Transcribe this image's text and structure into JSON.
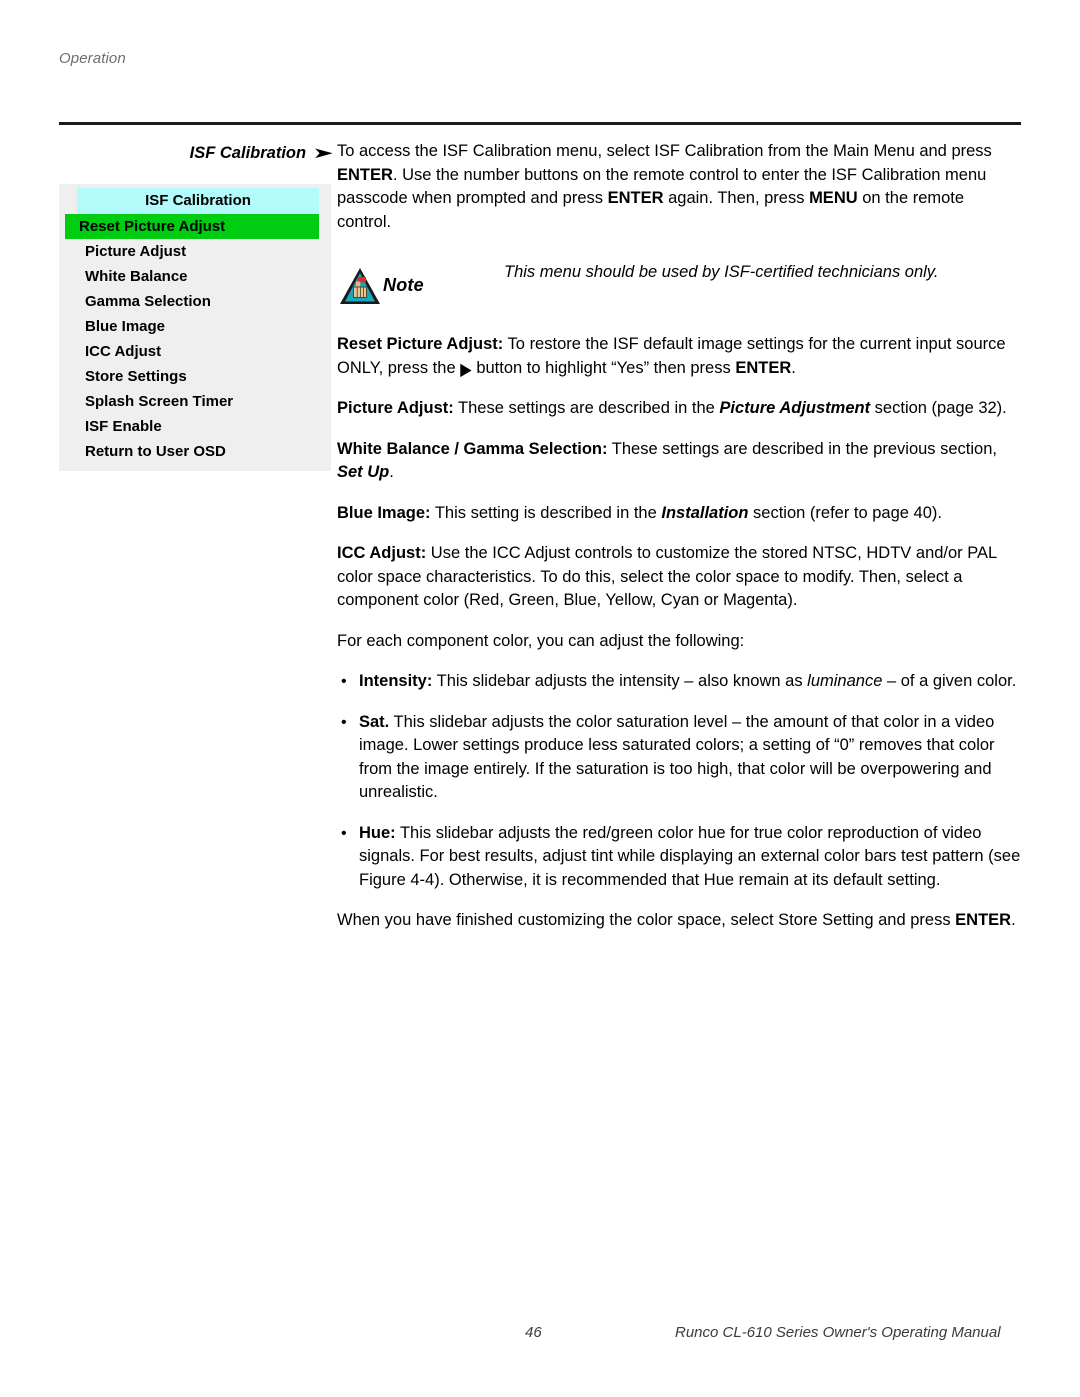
{
  "running_head": "Operation",
  "section": {
    "heading": "ISF Calibration",
    "heading_arrow": "➤"
  },
  "osd_menu": {
    "title": "ISF Calibration",
    "selected_index": 0,
    "header_color": "#b3fbfb",
    "highlight_color": "#00cc11",
    "background_color": "#efefef",
    "items": [
      {
        "label": "Reset Picture Adjust",
        "selected": true
      },
      {
        "label": "Picture Adjust",
        "selected": false
      },
      {
        "label": "White Balance",
        "selected": false
      },
      {
        "label": "Gamma Selection",
        "selected": false
      },
      {
        "label": "Blue Image",
        "selected": false
      },
      {
        "label": "ICC Adjust",
        "selected": false
      },
      {
        "label": "Store Settings",
        "selected": false
      },
      {
        "label": "Splash Screen Timer",
        "selected": false
      },
      {
        "label": "ISF Enable",
        "selected": false
      },
      {
        "label": "Return to User OSD",
        "selected": false
      }
    ]
  },
  "body": {
    "intro_p1_a": "To access the ISF Calibration menu, select ISF Calibration from the Main Menu and press ",
    "intro_p1_enter1": "ENTER",
    "intro_p1_b": ". Use the number buttons on the remote control to enter the ISF Calibration menu passcode when prompted and press ",
    "intro_p1_enter2": "ENTER",
    "intro_p1_c": " again. Then, press ",
    "intro_p1_menu": "MENU",
    "intro_p1_d": " on the remote control.",
    "note_label": "Note",
    "note_text": "This menu should be used by ISF-certified technicians only.",
    "reset_term": "Reset Picture Adjust:",
    "reset_a": " To restore the ISF default image settings for the current input source ONLY, press the ",
    "reset_arrow": "▶",
    "reset_b": " button to highlight “Yes” then press ",
    "reset_enter": "ENTER",
    "reset_c": ".",
    "picadj_term": "Picture Adjust:",
    "picadj_a": " These settings are described in the ",
    "picadj_ref": "Picture Adjustment",
    "picadj_b": " section (page 32).",
    "wbgamma_term": "White Balance / Gamma Selection:",
    "wbgamma_a": " These settings are described in the previous section, ",
    "wbgamma_ref": "Set Up",
    "wbgamma_b": ".",
    "blue_term": "Blue Image:",
    "blue_a": " This setting is described in the ",
    "blue_ref": "Installation",
    "blue_b": " section (refer to page 40).",
    "icc_term": "ICC Adjust:",
    "icc_a": " Use the ICC Adjust controls to customize the stored NTSC, HDTV and/or PAL color space characteristics. To do this, select the color space to modify. Then, select a component color (Red, Green, Blue, Yellow, Cyan or Magenta).",
    "foreach_text": "For each component color, you can adjust the following:",
    "bullet_char": "•",
    "intensity_term": "Intensity:",
    "intensity_a": " This slidebar adjusts the intensity – also known as ",
    "intensity_em": "luminance",
    "intensity_b": " – of a given color.",
    "sat_term": "Sat.",
    "sat_a": " This slidebar adjusts the color saturation level – the amount of that color in a video image. Lower settings produce less saturated colors; a setting of “0” removes that color from the image entirely. If the saturation is too high, that color will be overpowering and unrealistic.",
    "hue_term": "Hue:",
    "hue_a": " This slidebar adjusts the red/green color hue for true color reproduction of video signals. For best results, adjust tint while displaying an external color bars test pattern (see Figure 4-4). Otherwise, it is recommended that Hue remain at its default setting.",
    "closing_a": "When you have finished customizing the color space, select Store Setting and press ",
    "closing_enter": "ENTER",
    "closing_b": "."
  },
  "footer": {
    "page_number": "46",
    "manual_title": "Runco CL-610 Series Owner's Operating Manual"
  }
}
